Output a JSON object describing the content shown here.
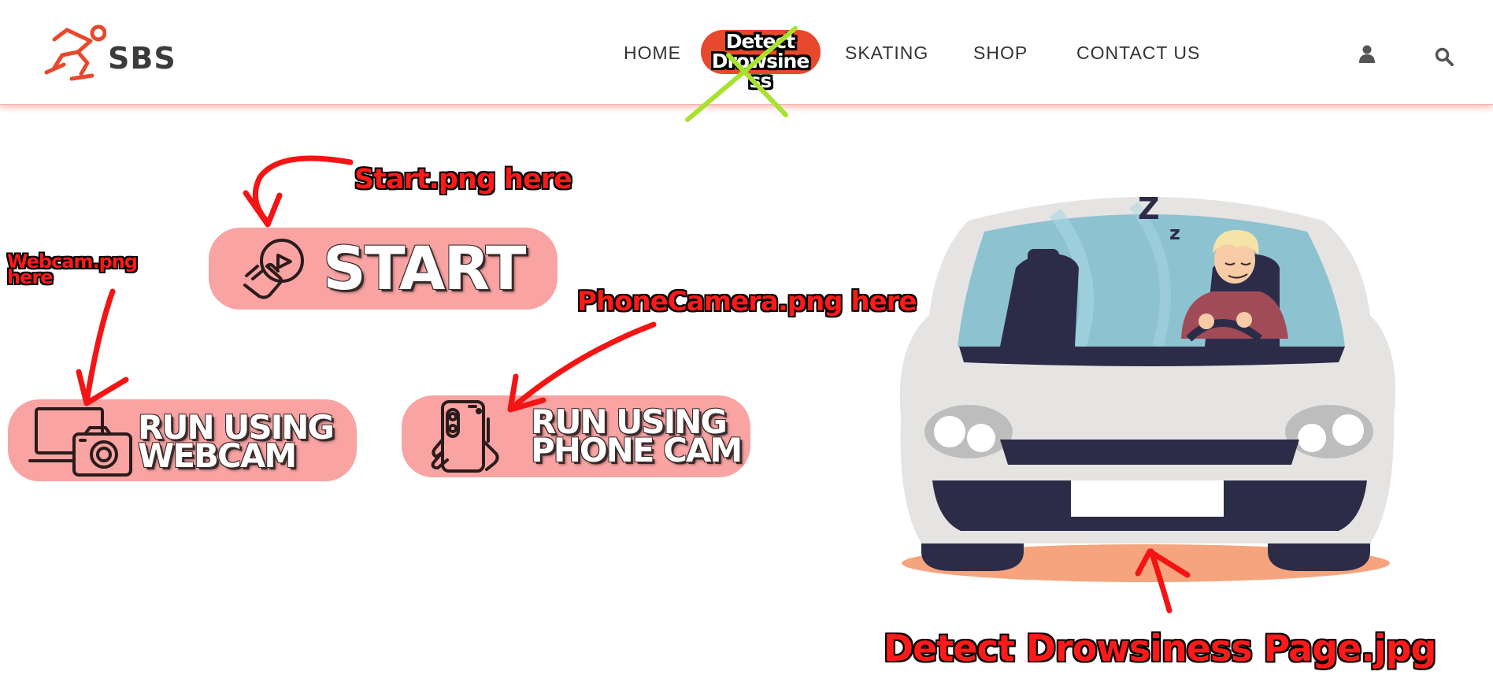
{
  "header": {
    "logo_text": "SBS",
    "nav": [
      {
        "label": "HOME"
      },
      {
        "label": "Detect Drowsiness"
      },
      {
        "label": "SKATING"
      },
      {
        "label": "SHOP"
      },
      {
        "label": "CONTACT US"
      }
    ],
    "icons": [
      "user-icon",
      "search-icon"
    ]
  },
  "buttons": {
    "start": {
      "label": "START",
      "icon": "hand-pointer-icon"
    },
    "webcam": {
      "line1": "RUN USING",
      "line2": "WEBCAM",
      "icon": "laptop-camera-icon"
    },
    "phone": {
      "line1": "RUN USING",
      "line2": "PHONE CAM",
      "icon": "phone-in-hand-icon"
    }
  },
  "annotations": {
    "start": "Start.png here",
    "webcam_line1": "Webcam.png",
    "webcam_line2": "here",
    "phone": "PhoneCamera.png here",
    "page_image": "Detect Drowsiness Page.jpg"
  },
  "colors": {
    "accent": "#e8482c",
    "button_bg": "#f9a3a3",
    "annotation_red": "#ff1a1a",
    "annotation_green": "#9be21a"
  }
}
